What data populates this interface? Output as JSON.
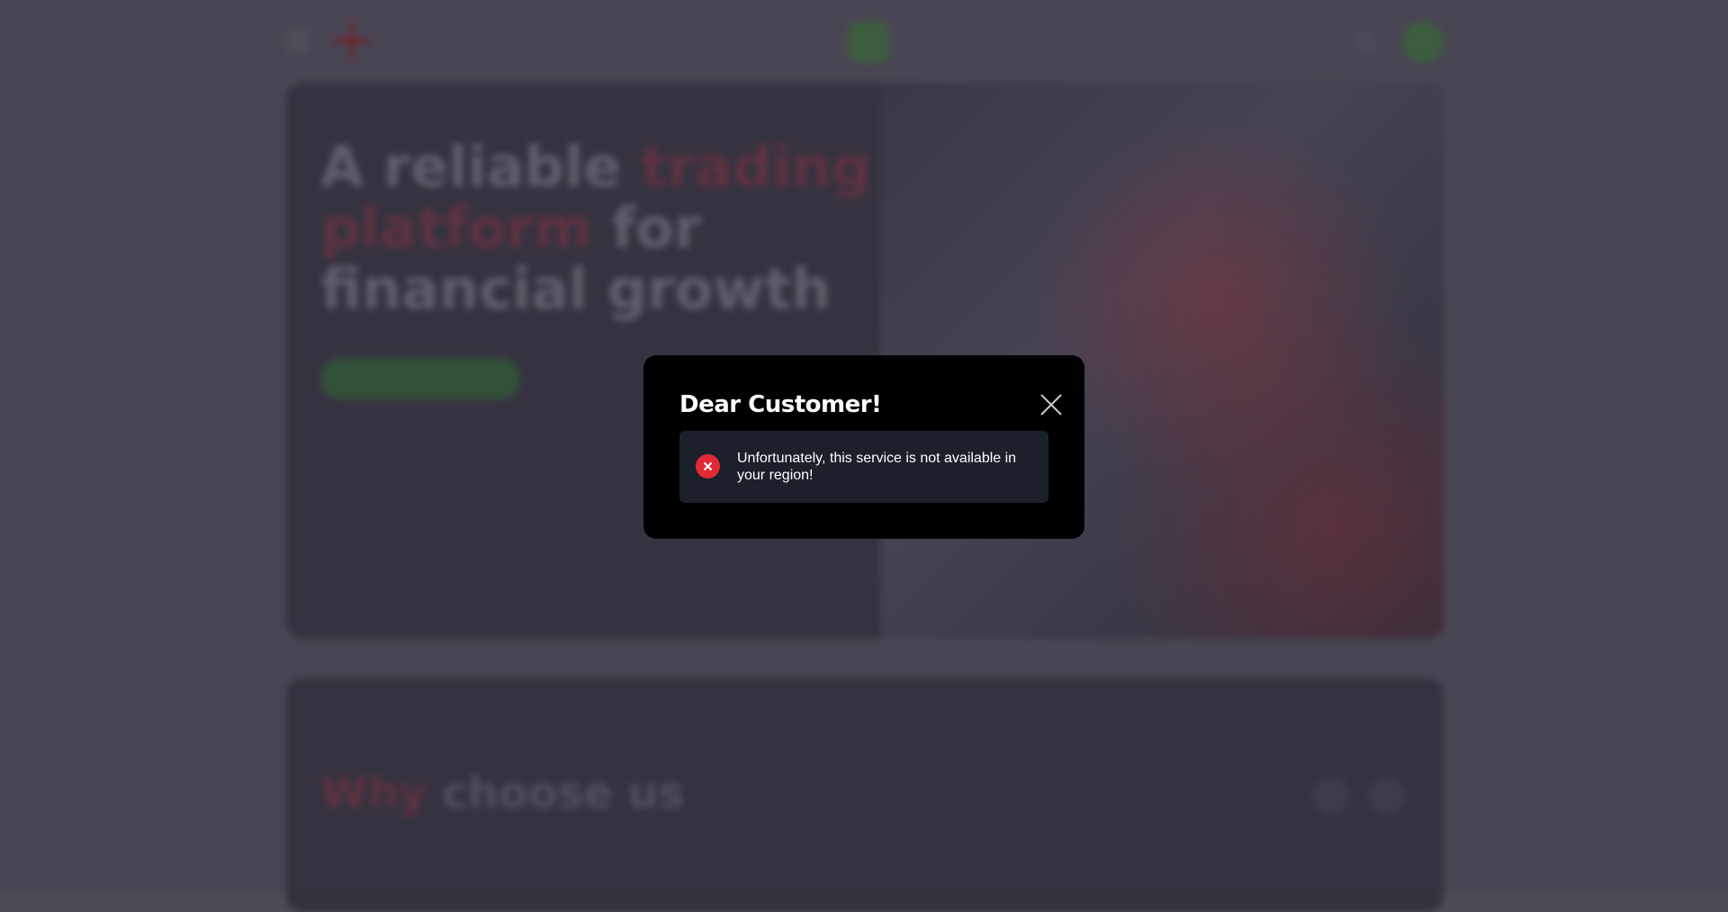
{
  "modal": {
    "title": "Dear Customer!",
    "message": "Unfortunately, this service is not available in your region!",
    "close_icon": "close-icon",
    "alert_icon": "error-x-icon",
    "alert_color": "#e02a35"
  },
  "hero": {
    "title_part1": "A reliable ",
    "title_accent": "trading platform",
    "title_part2": " for financial growth"
  },
  "section": {
    "title_accent": "Why",
    "title_rest": " choose us"
  },
  "colors": {
    "brand_green": "#3e6a3c",
    "accent_red": "#6a3040",
    "modal_bg": "#000000"
  }
}
